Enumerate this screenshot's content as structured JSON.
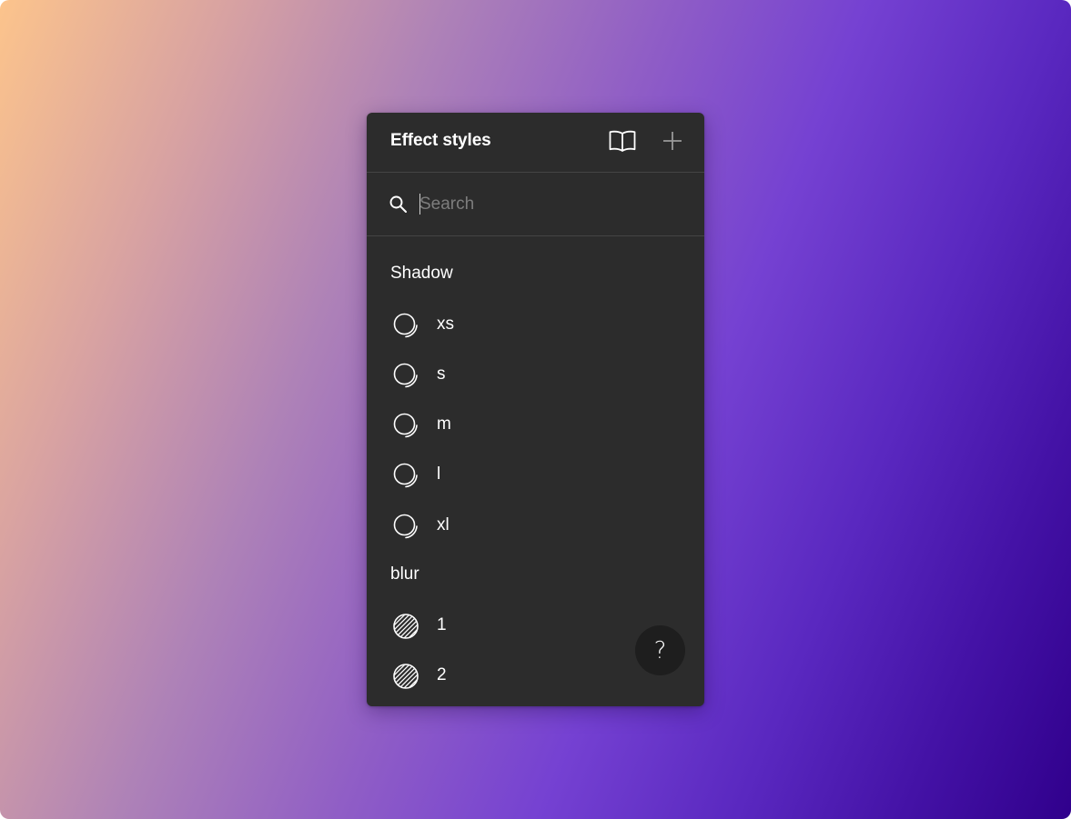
{
  "panel": {
    "title": "Effect styles",
    "header_icons": [
      "book-open-icon",
      "plus-icon"
    ]
  },
  "search": {
    "placeholder": "Search",
    "value": "",
    "icon": "search-icon"
  },
  "sections": [
    {
      "title": "Shadow",
      "item_icon": "drop-shadow-icon",
      "items": [
        {
          "label": "xs"
        },
        {
          "label": "s"
        },
        {
          "label": "m"
        },
        {
          "label": "l"
        },
        {
          "label": "xl"
        }
      ]
    },
    {
      "title": "blur",
      "item_icon": "blur-icon",
      "items": [
        {
          "label": "1"
        },
        {
          "label": "2"
        }
      ]
    }
  ],
  "help": {
    "glyph": "?",
    "icon": "help-icon"
  },
  "colors": {
    "panel_bg": "#2c2c2c",
    "divider": "#444444",
    "text": "#ffffff",
    "placeholder": "#7d7d7d",
    "help_bg": "#1e1e1e"
  }
}
